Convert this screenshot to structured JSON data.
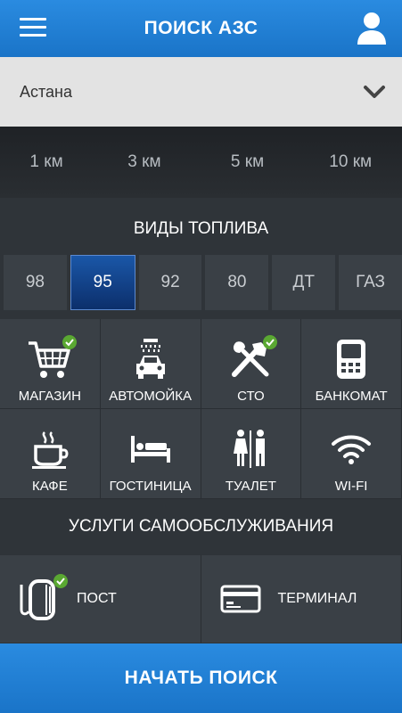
{
  "header": {
    "title": "ПОИСК АЗС",
    "menu_icon": "menu-icon",
    "user_icon": "user-icon",
    "accent": "#1f80d4"
  },
  "city": {
    "value": "Астана",
    "icon": "chevron-down-icon"
  },
  "radius": {
    "options": [
      "1 км",
      "3 км",
      "5 км",
      "10 км"
    ]
  },
  "fuel": {
    "title": "ВИДЫ ТОПЛИВА",
    "options": [
      "98",
      "95",
      "92",
      "80",
      "ДТ",
      "ГАЗ"
    ],
    "selected": "95"
  },
  "services": {
    "items": [
      {
        "label": "МАГАЗИН",
        "icon": "cart-icon",
        "checked": true
      },
      {
        "label": "АВТОМОЙКА",
        "icon": "car-wash-icon",
        "checked": false
      },
      {
        "label": "СТО",
        "icon": "tools-icon",
        "checked": true
      },
      {
        "label": "БАНКОМАТ",
        "icon": "atm-icon",
        "checked": false
      },
      {
        "label": "КАФЕ",
        "icon": "coffee-icon",
        "checked": false
      },
      {
        "label": "ГОСТИНИЦА",
        "icon": "bed-icon",
        "checked": false
      },
      {
        "label": "ТУАЛЕТ",
        "icon": "toilet-icon",
        "checked": false
      },
      {
        "label": "WI-FI",
        "icon": "wifi-icon",
        "checked": false
      }
    ],
    "check_color": "#5aa832"
  },
  "self_service": {
    "title": "УСЛУГИ САМООБСЛУЖИВАНИЯ",
    "items": [
      {
        "label": "ПОСТ",
        "icon": "fuel-post-icon",
        "checked": true
      },
      {
        "label": "ТЕРМИНАЛ",
        "icon": "card-terminal-icon",
        "checked": false
      }
    ]
  },
  "start_button": {
    "label": "НАЧАТЬ ПОИСК"
  }
}
